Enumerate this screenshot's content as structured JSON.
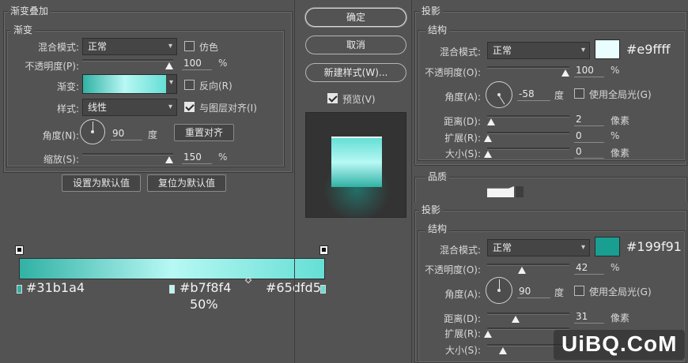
{
  "gradient_overlay": {
    "title": "渐变叠加",
    "section": "渐变",
    "blend_mode_label": "混合模式:",
    "blend_mode_value": "正常",
    "dither_label": "仿色",
    "opacity_label": "不透明度(P):",
    "opacity_value": "100",
    "opacity_unit": "%",
    "opacity_level": 100,
    "gradient_label": "渐变:",
    "reverse_label": "反向(R)",
    "style_label": "样式:",
    "style_value": "线性",
    "align_label": "与图层对齐(I)",
    "angle_label": "角度(N):",
    "angle_value": "90",
    "angle_unit": "度",
    "reset_align_button": "重置对齐",
    "scale_label": "缩放(S):",
    "scale_value": "150",
    "scale_unit": "%",
    "scale_level": 150,
    "set_default_button": "设置为默认值",
    "reset_default_button": "复位为默认值"
  },
  "gradient_stops": {
    "left": "#31b1a4",
    "mid": "#b7f8f4",
    "right": "#65dfd5",
    "mid_location": "50%"
  },
  "buttons": {
    "ok": "确定",
    "cancel": "取消",
    "new_style": "新建样式(W)...",
    "preview": "预览(V)"
  },
  "drop_shadow_1": {
    "title": "投影",
    "section": "结构",
    "blend_mode_label": "混合模式:",
    "blend_mode_value": "正常",
    "color": "#e9ffff",
    "opacity_label": "不透明度(O):",
    "opacity_value": "100",
    "opacity_unit": "%",
    "opacity_level": 100,
    "angle_label": "角度(A):",
    "angle_value": "-58",
    "angle_unit": "度",
    "global_light_label": "使用全局光(G)",
    "distance_label": "距离(D):",
    "distance_value": "2",
    "distance_unit": "像素",
    "spread_label": "扩展(R):",
    "spread_value": "0",
    "spread_unit": "%",
    "size_label": "大小(S):",
    "size_value": "0",
    "size_unit": "像素",
    "quality_title": "品质"
  },
  "drop_shadow_2": {
    "title": "投影",
    "section": "结构",
    "blend_mode_label": "混合模式:",
    "blend_mode_value": "正常",
    "color": "#199f91",
    "opacity_label": "不透明度(O):",
    "opacity_value": "42",
    "opacity_unit": "%",
    "opacity_level": 42,
    "angle_label": "角度(A):",
    "angle_value": "90",
    "angle_unit": "度",
    "global_light_label": "使用全局光(G)",
    "distance_label": "距离(D):",
    "distance_value": "31",
    "distance_unit": "像素",
    "spread_label": "扩展(R):",
    "size_label": "大小(S):"
  },
  "watermark": "UiBQ.CoM"
}
